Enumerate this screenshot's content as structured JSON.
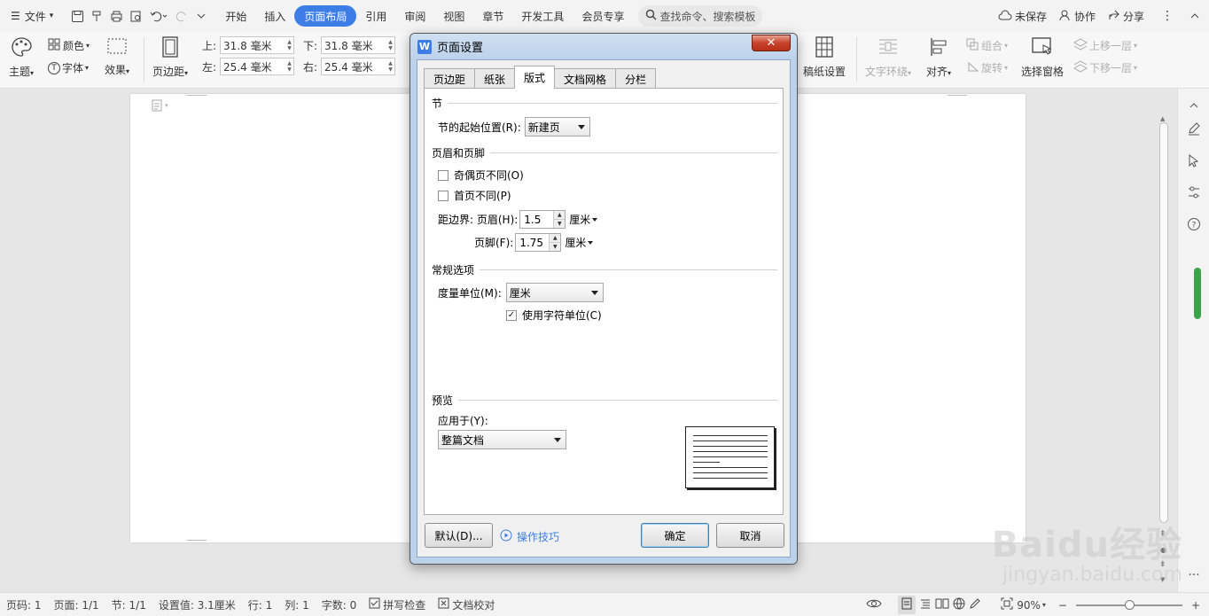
{
  "menubar": {
    "file_label": "文件",
    "tabs": [
      {
        "label": "开始",
        "active": false
      },
      {
        "label": "插入",
        "active": false
      },
      {
        "label": "页面布局",
        "active": true
      },
      {
        "label": "引用",
        "active": false
      },
      {
        "label": "审阅",
        "active": false
      },
      {
        "label": "视图",
        "active": false
      },
      {
        "label": "章节",
        "active": false
      },
      {
        "label": "开发工具",
        "active": false
      },
      {
        "label": "会员专享",
        "active": false
      }
    ],
    "search_placeholder": "查找命令、搜索模板",
    "unsaved": "未保存",
    "collab": "协作",
    "share": "分享"
  },
  "ribbon": {
    "theme": "主题",
    "color": "颜色",
    "font": "字体",
    "effect": "效果",
    "margins": "页边距",
    "margin_top_label": "上:",
    "margin_top": "31.8 毫米",
    "margin_bottom_label": "下:",
    "margin_bottom": "31.8 毫米",
    "margin_left_label": "左:",
    "margin_left": "25.4 毫米",
    "margin_right_label": "右:",
    "margin_right": "25.4 毫米",
    "manuscript": "稿纸设置",
    "text_wrap": "文字环绕",
    "align": "对齐",
    "group": "组合",
    "rotate": "旋转",
    "selection_pane": "选择窗格",
    "bring_forward": "上移一层",
    "send_backward": "下移一层"
  },
  "dialog": {
    "title": "页面设置",
    "close": "✕",
    "tabs": [
      {
        "label": "页边距",
        "active": false
      },
      {
        "label": "纸张",
        "active": false
      },
      {
        "label": "版式",
        "active": true
      },
      {
        "label": "文档网格",
        "active": false
      },
      {
        "label": "分栏",
        "active": false
      }
    ],
    "section_label": "节",
    "section_start_label": "节的起始位置(R):",
    "section_start_value": "新建页",
    "header_footer_label": "页眉和页脚",
    "odd_even_label": "奇偶页不同(O)",
    "odd_even_checked": false,
    "first_page_label": "首页不同(P)",
    "first_page_checked": false,
    "edge_header_label": "距边界: 页眉(H):",
    "edge_header_value": "1.5",
    "edge_footer_label": "页脚(F):",
    "edge_footer_value": "1.75",
    "unit_cm": "厘米",
    "general_label": "常规选项",
    "measure_label": "度量单位(M):",
    "measure_value": "厘米",
    "char_unit_label": "使用字符单位(C)",
    "char_unit_checked": true,
    "preview_label": "预览",
    "apply_to_label": "应用于(Y):",
    "apply_to_value": "整篇文档",
    "default_btn": "默认(D)...",
    "tips_label": "操作技巧",
    "ok_btn": "确定",
    "cancel_btn": "取消"
  },
  "statusbar": {
    "page_no": "页码: 1",
    "pages": "页面: 1/1",
    "section": "节: 1/1",
    "setting": "设置值: 3.1厘米",
    "row": "行: 1",
    "col": "列: 1",
    "words": "字数: 0",
    "spell": "拼写检查",
    "proof": "文档校对",
    "zoom": "90%"
  },
  "watermark": {
    "brand": "Baidu经验",
    "url": "jingyan.baidu.com"
  },
  "colors": {
    "accent": "#3d7ee6",
    "dialog_frame": "#bcd1ea",
    "close_red": "#c7422b"
  }
}
